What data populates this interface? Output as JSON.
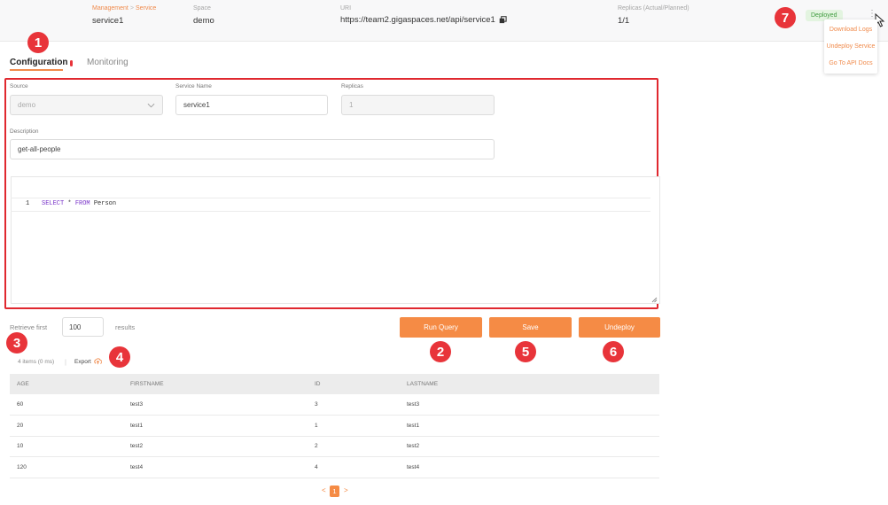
{
  "header": {
    "breadcrumb": {
      "management": "Management",
      "separator": ">",
      "service": "Service"
    },
    "service_value": "service1",
    "space_label": "Space",
    "space_value": "demo",
    "uri_label": "URI",
    "uri_value": "https://team2.gigaspaces.net/api/service1",
    "replicas_label": "Replicas (Actual/Planned)",
    "replicas_value": "1/1",
    "status_badge": "Deployed",
    "kebab": "⋮"
  },
  "menu": {
    "items": [
      "Download Logs",
      "Undeploy Service",
      "Go To API Docs"
    ]
  },
  "markers": [
    "1",
    "2",
    "3",
    "4",
    "5",
    "6",
    "7"
  ],
  "tabs": {
    "configuration": "Configuration",
    "monitoring": "Monitoring"
  },
  "form": {
    "source_label": "Source",
    "source_value": "demo",
    "service_name_label": "Service Name",
    "service_name_value": "service1",
    "replicas_label": "Replicas",
    "replicas_value": "1",
    "description_label": "Description",
    "description_value": "get-all-people"
  },
  "editor": {
    "line_number": "1",
    "tokens": {
      "select": "SELECT",
      "star": " * ",
      "from": "FROM",
      "table": " Person"
    }
  },
  "query": {
    "retrieve_label": "Retrieve first",
    "limit_value": "100",
    "results_label": "results"
  },
  "buttons": {
    "run_query": "Run Query",
    "save": "Save",
    "undeploy": "Undeploy"
  },
  "results": {
    "count_text": "4 items (0 ms)",
    "divider": "|",
    "export_label": "Export"
  },
  "table": {
    "columns": [
      "AGE",
      "FIRSTNAME",
      "ID",
      "LASTNAME"
    ],
    "rows": [
      [
        "60",
        "test3",
        "3",
        "test3"
      ],
      [
        "20",
        "test1",
        "1",
        "test1"
      ],
      [
        "10",
        "test2",
        "2",
        "test2"
      ],
      [
        "120",
        "test4",
        "4",
        "test4"
      ]
    ]
  },
  "pagination": {
    "prev": "<",
    "current": "1",
    "next": ">"
  },
  "colors": {
    "accent": "#f58b45",
    "marker": "#e8343a",
    "deployed_bg": "#e3f4e0",
    "deployed_text": "#3f9b3f"
  },
  "icons": [
    "copy-icon",
    "chevron-down-icon",
    "export-icon",
    "resize-handle-icon",
    "cursor-icon",
    "kebab-menu-icon"
  ]
}
